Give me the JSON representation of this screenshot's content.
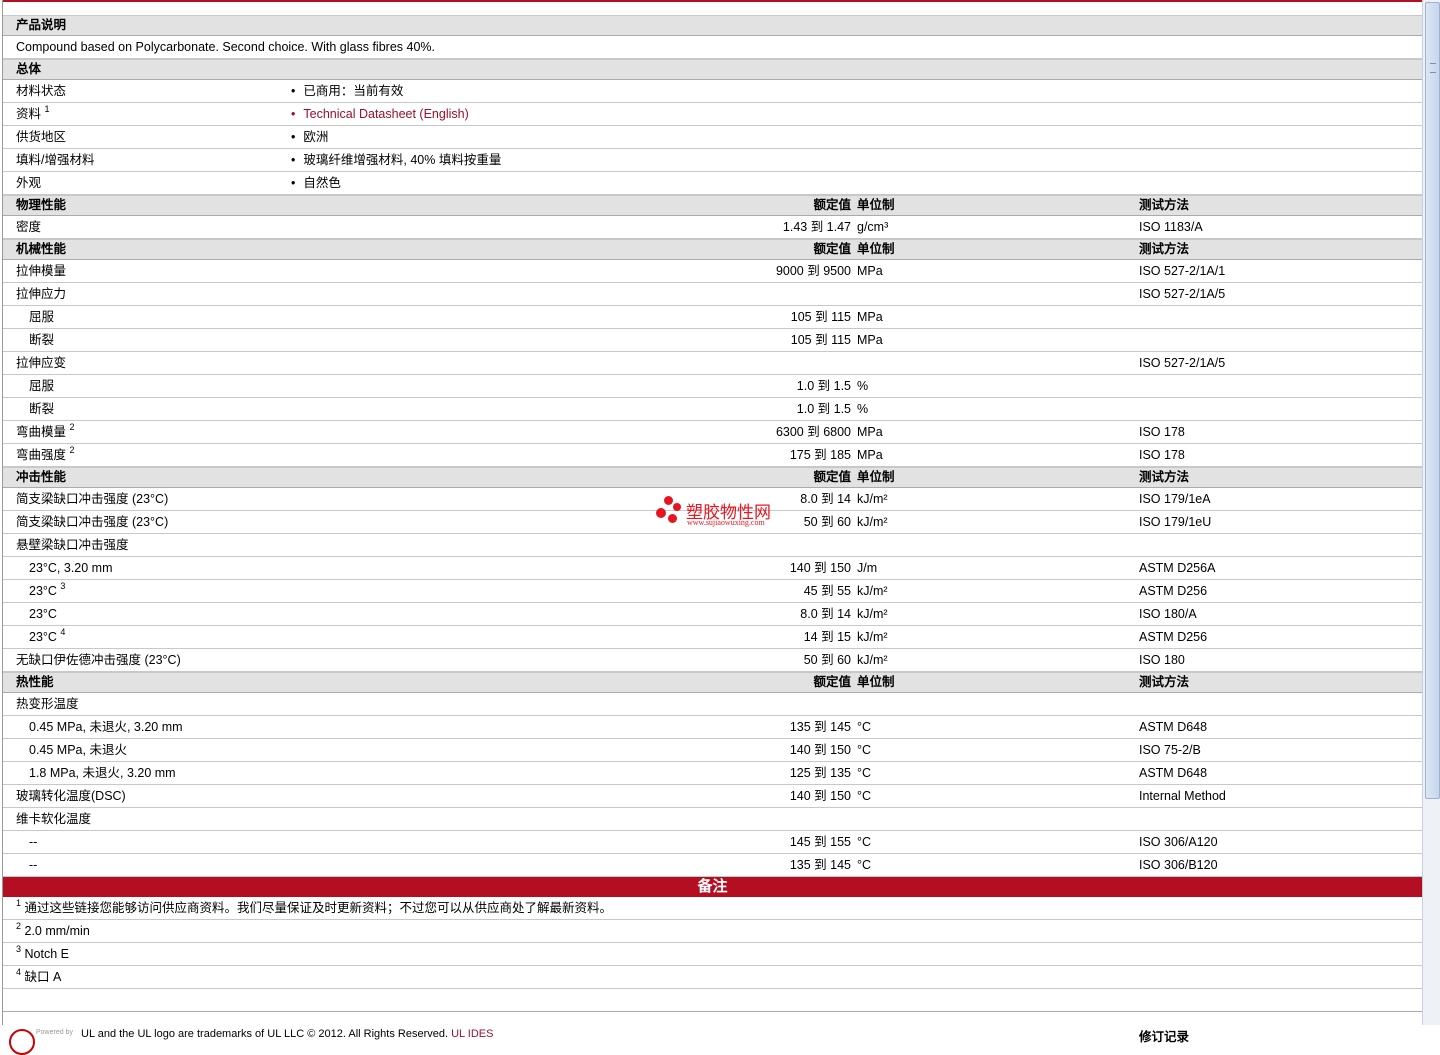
{
  "sections": [
    {
      "type": "header",
      "title": "产品说明"
    },
    {
      "type": "text",
      "label": "Compound based on Polycarbonate. Second choice. With glass fibres 40%."
    },
    {
      "type": "header",
      "title": "总体"
    },
    {
      "type": "bullet",
      "label": "材料状态",
      "value": "已商用：当前有效"
    },
    {
      "type": "bullet",
      "label": "资料",
      "sup": "1",
      "value": "Technical Datasheet (English)",
      "link": true
    },
    {
      "type": "bullet",
      "label": "供货地区",
      "value": "欧洲"
    },
    {
      "type": "bullet",
      "label": "填料/增强材料",
      "value": "玻璃纤维增强材料, 40% 填料按重量"
    },
    {
      "type": "bullet",
      "label": "外观",
      "value": "自然色"
    },
    {
      "type": "header",
      "title": "物理性能",
      "value": "额定值",
      "unit": "单位制",
      "test": "测试方法"
    },
    {
      "type": "data",
      "label": "密度",
      "value": "1.43 到  1.47",
      "unit": "g/cm³",
      "test": "ISO 1183/A"
    },
    {
      "type": "header",
      "title": "机械性能",
      "value": "额定值",
      "unit": "单位制",
      "test": "测试方法"
    },
    {
      "type": "data",
      "label": "拉伸模量",
      "value": "9000 到  9500",
      "unit": "MPa",
      "test": "ISO 527-2/1A/1"
    },
    {
      "type": "data",
      "label": "拉伸应力",
      "value": "",
      "unit": "",
      "test": "ISO 527-2/1A/5"
    },
    {
      "type": "data",
      "label": "屈服",
      "indent": true,
      "value": "105 到  115",
      "unit": "MPa",
      "test": ""
    },
    {
      "type": "data",
      "label": "断裂",
      "indent": true,
      "value": "105 到  115",
      "unit": "MPa",
      "test": ""
    },
    {
      "type": "data",
      "label": "拉伸应变",
      "value": "",
      "unit": "",
      "test": "ISO 527-2/1A/5"
    },
    {
      "type": "data",
      "label": "屈服",
      "indent": true,
      "value": "1.0 到  1.5",
      "unit": "%",
      "test": ""
    },
    {
      "type": "data",
      "label": "断裂",
      "indent": true,
      "value": "1.0 到  1.5",
      "unit": "%",
      "test": ""
    },
    {
      "type": "data",
      "label": "弯曲模量",
      "sup": "2",
      "value": "6300 到  6800",
      "unit": "MPa",
      "test": "ISO 178"
    },
    {
      "type": "data",
      "label": "弯曲强度",
      "sup": "2",
      "value": "175 到  185",
      "unit": "MPa",
      "test": "ISO 178"
    },
    {
      "type": "header",
      "title": "冲击性能",
      "value": "额定值",
      "unit": "单位制",
      "test": "测试方法"
    },
    {
      "type": "data",
      "label": "简支梁缺口冲击强度  (23°C)",
      "value": "8.0 到  14",
      "unit": "kJ/m²",
      "test": "ISO 179/1eA"
    },
    {
      "type": "data",
      "label": "简支梁缺口冲击强度  (23°C)",
      "value": "50 到  60",
      "unit": "kJ/m²",
      "test": "ISO 179/1eU"
    },
    {
      "type": "data",
      "label": "悬壁梁缺口冲击强度",
      "value": "",
      "unit": "",
      "test": ""
    },
    {
      "type": "data",
      "label": "23°C, 3.20 mm",
      "indent": true,
      "value": "140 到  150",
      "unit": "J/m",
      "test": "ASTM D256A"
    },
    {
      "type": "data",
      "label": "23°C",
      "sup": "3",
      "indent": true,
      "value": "45 到  55",
      "unit": "kJ/m²",
      "test": "ASTM D256"
    },
    {
      "type": "data",
      "label": "23°C",
      "indent": true,
      "value": "8.0 到  14",
      "unit": "kJ/m²",
      "test": "ISO 180/A"
    },
    {
      "type": "data",
      "label": "23°C",
      "sup": "4",
      "indent": true,
      "value": "14 到  15",
      "unit": "kJ/m²",
      "test": "ASTM D256"
    },
    {
      "type": "data",
      "label": "无缺口伊佐德冲击强度  (23°C)",
      "value": "50 到  60",
      "unit": "kJ/m²",
      "test": "ISO 180"
    },
    {
      "type": "header",
      "title": "热性能",
      "value": "额定值",
      "unit": "单位制",
      "test": "测试方法"
    },
    {
      "type": "data",
      "label": "热变形温度",
      "value": "",
      "unit": "",
      "test": ""
    },
    {
      "type": "data",
      "label": "0.45 MPa, 未退火, 3.20 mm",
      "indent": true,
      "value": "135 到  145",
      "unit": "°C",
      "test": "ASTM D648"
    },
    {
      "type": "data",
      "label": "0.45 MPa, 未退火",
      "indent": true,
      "value": "140 到  150",
      "unit": "°C",
      "test": "ISO 75-2/B"
    },
    {
      "type": "data",
      "label": "1.8 MPa, 未退火, 3.20 mm",
      "indent": true,
      "value": "125 到  135",
      "unit": "°C",
      "test": "ASTM D648"
    },
    {
      "type": "data",
      "label": "玻璃转化温度(DSC)",
      "value": "140 到  150",
      "unit": "°C",
      "test": "Internal Method"
    },
    {
      "type": "data",
      "label": "维卡软化温度",
      "value": "",
      "unit": "",
      "test": ""
    },
    {
      "type": "data",
      "label": "--",
      "indent": true,
      "value": "145 到  155",
      "unit": "°C",
      "test": "ISO 306/A120"
    },
    {
      "type": "data",
      "label": "--",
      "indent": true,
      "value": "135 到  145",
      "unit": "°C",
      "test": "ISO 306/B120"
    }
  ],
  "notes": {
    "title": "备注",
    "items": [
      {
        "num": "1",
        "text": "通过这些链接您能够访问供应商资料。我们尽量保证及时更新资料；不过您可以从供应商处了解最新资料。"
      },
      {
        "num": "2",
        "text": "2.0 mm/min"
      },
      {
        "num": "3",
        "text": "Notch E"
      },
      {
        "num": "4",
        "text": "缺口  A"
      }
    ]
  },
  "footer": {
    "powered_by": "Powered by",
    "trademark": "UL and the UL logo are trademarks of UL LLC © 2012. All Rights Reserved.",
    "ul_link": "UL IDES",
    "revision": "修订记录"
  },
  "watermark": {
    "name": "塑胶物性网",
    "url": "www.sujiaowuxing.com"
  },
  "colors": {
    "accent": "#b40e23",
    "header_bg": "#e2e2e2",
    "link": "#9b0f2a"
  }
}
